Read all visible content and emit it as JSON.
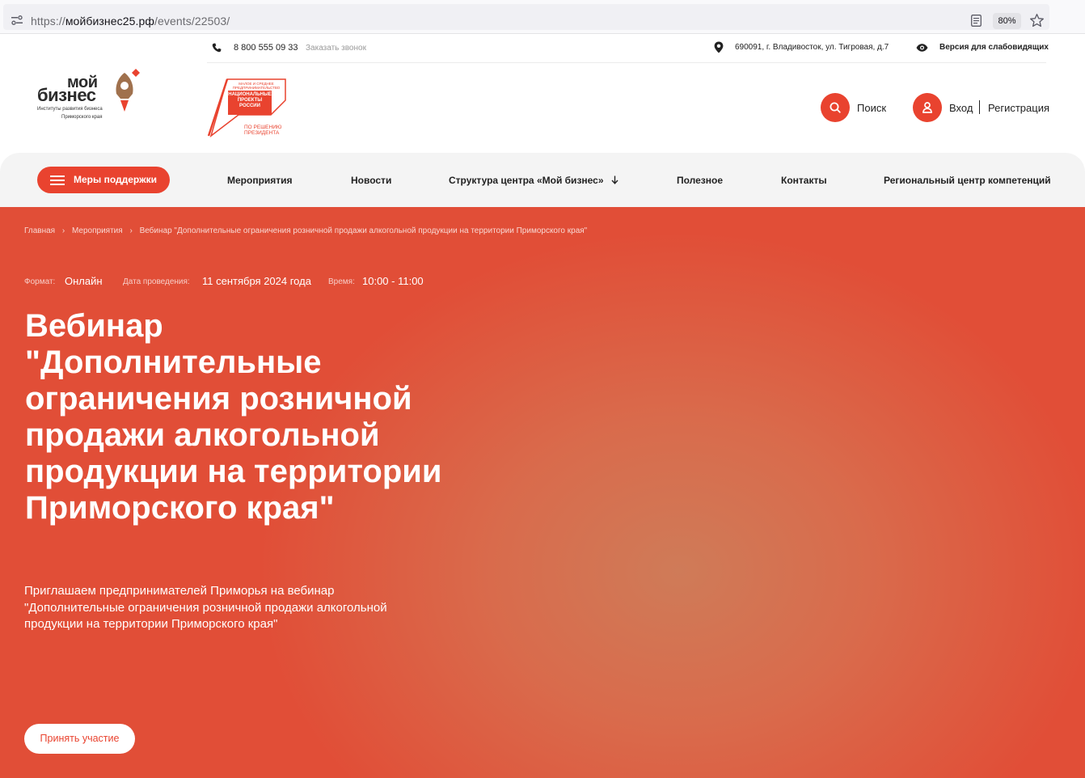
{
  "browser": {
    "url_scheme": "https://",
    "url_host": "мойбизнес25.рф",
    "url_path": "/events/22503/",
    "zoom": "80%"
  },
  "topbar": {
    "phone": "8 800 555 09 33",
    "callback_label": "Заказать звонок",
    "address": "690091, г. Владивосток, ул. Тигровая, д.7",
    "low_vision_label": "Версия для слабовидящих"
  },
  "logo": {
    "word1": "мой",
    "word2": "бизнес",
    "sub1": "Институты развития бизнеса",
    "sub2": "Приморского края"
  },
  "np_logo": {
    "small": "МАЛОЕ И СРЕДНЕЕ ПРЕДПРИНИМАТЕЛЬСТВО",
    "box": "НАЦИОНАЛЬНЫЕ ПРОЕКТЫ РОССИИ",
    "sub1": "ПО РЕШЕНИЮ",
    "sub2": "ПРЕЗИДЕНТА"
  },
  "header": {
    "search_label": "Поиск",
    "login_label": "Вход",
    "register_label": "Регистрация"
  },
  "nav": {
    "support_label": "Меры поддержки",
    "items": [
      "Мероприятия",
      "Новости",
      "Структура центра «Мой бизнес»",
      "Полезное",
      "Контакты",
      "Региональный центр компетенций"
    ]
  },
  "breadcrumb": {
    "items": [
      "Главная",
      "Мероприятия",
      "Вебинар \"Дополнительные ограничения розничной продажи алкогольной продукции на территории Приморского края\""
    ],
    "separator": "›"
  },
  "event": {
    "format_label": "Формат:",
    "format_value": "Онлайн",
    "date_label": "Дата проведения:",
    "date_value": "11 сентября 2024 года",
    "time_label": "Время:",
    "time_value": "10:00 - 11:00",
    "title": "Вебинар \"Дополнительные ограничения розничной продажи алкогольной продукции на территории Приморского края\"",
    "lead": "Приглашаем предпринимателей Приморья на вебинар \"Дополнительные ограничения розничной продажи алкогольной продукции на территории Приморского края\"",
    "join_label": "Принять участие"
  },
  "colors": {
    "brand": "#e9432f",
    "hero_glow": "#cf7b58"
  }
}
